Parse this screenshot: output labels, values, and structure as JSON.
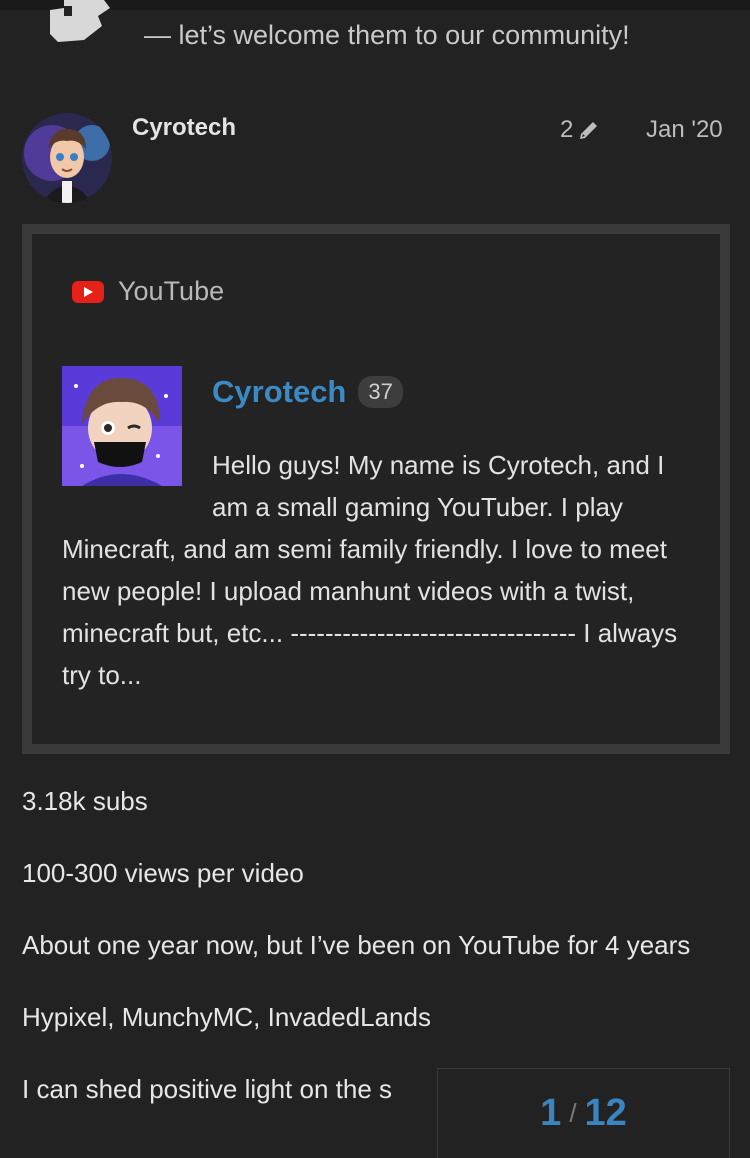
{
  "welcome": {
    "text": "— let’s welcome them to our community!"
  },
  "post": {
    "author": "Cyrotech",
    "edit_count": "2",
    "date": "Jan '20"
  },
  "onebox": {
    "provider": "YouTube",
    "channel_name": "Cyrotech",
    "channel_badge": "37",
    "description": "Hello guys! My name is Cyrotech, and I am a small gaming YouTuber. I play Minecraft, and am semi family friendly. I love to meet new people! I upload manhunt videos with a twist, minecraft but, etc... --------------------------------- I always try to..."
  },
  "content": {
    "lines": [
      "3.18k subs",
      "100-300 views per video",
      "About one year now, but I’ve been on YouTube for 4 years",
      "Hypixel, MunchyMC, InvadedLands",
      "I can shed positive light on the s"
    ]
  },
  "progress": {
    "current": "1",
    "separator": "/",
    "total": "12"
  },
  "colors": {
    "background": "#222222",
    "link": "#3c8ac4",
    "youtube": "#e62117"
  }
}
